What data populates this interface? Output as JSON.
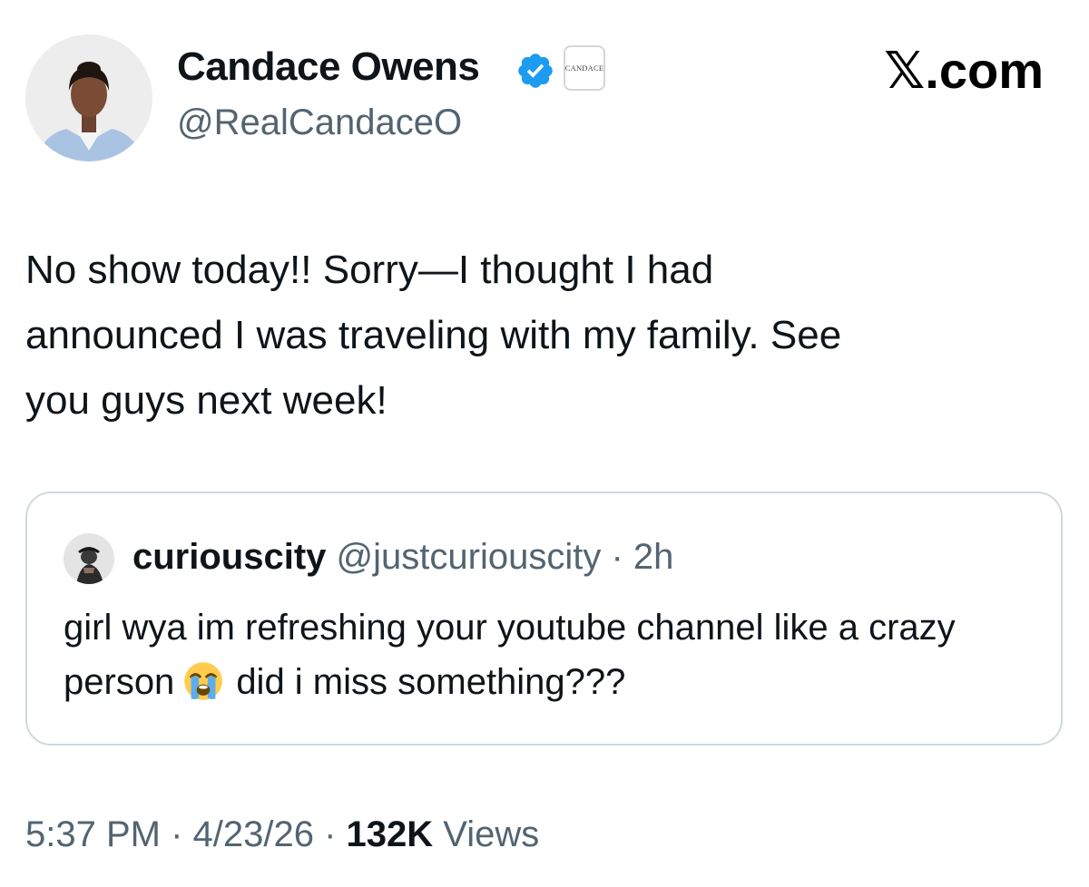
{
  "author": {
    "display_name": "Candace Owens",
    "handle": "@RealCandaceO",
    "verified_icon": "verified-badge-icon",
    "affiliate_label": "CANDACE"
  },
  "site": {
    "label": "𝕏.com"
  },
  "tweet": {
    "text": "No show today!! Sorry—I thought I had\nannounced I was traveling with my family. See\nyou guys next week!"
  },
  "quote": {
    "display_name": "curiouscity",
    "handle": "@justcuriouscity",
    "separator": " · ",
    "time": "2h",
    "text_before_emoji": "girl wya im refreshing your youtube channel like a crazy person",
    "emoji_icon": "loudly-crying-face-icon",
    "text_after_emoji": "did i miss something???"
  },
  "meta": {
    "time": "5:37 PM",
    "separator": " · ",
    "date": "4/23/26",
    "views_count": "132K",
    "views_label": " Views"
  },
  "colors": {
    "text_primary": "#0f1419",
    "text_secondary": "#536471",
    "verified_blue": "#1d9bf0",
    "border": "#cfd9de"
  }
}
